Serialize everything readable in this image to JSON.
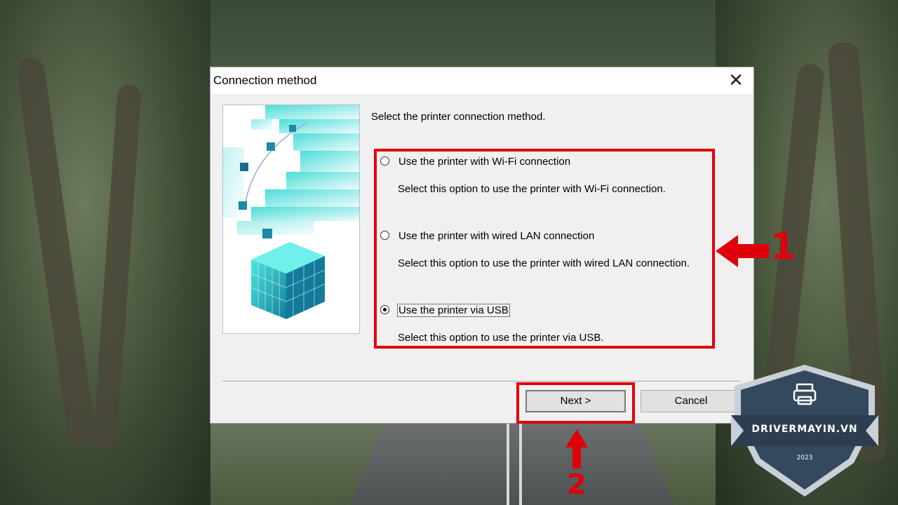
{
  "dialog": {
    "title": "Connection method",
    "close_glyph": "✕",
    "prompt": "Select the printer connection method.",
    "options": [
      {
        "label": "Use the printer with Wi-Fi connection",
        "description": "Select this option to use the printer with Wi-Fi connection.",
        "selected": false
      },
      {
        "label": "Use the printer with wired LAN connection",
        "description": "Select this option to use the printer with wired LAN connection.",
        "selected": false
      },
      {
        "label": "Use the printer via USB",
        "description": "Select this option to use the printer via USB.",
        "selected": true
      }
    ],
    "buttons": {
      "next": "Next >",
      "cancel": "Cancel"
    }
  },
  "annotations": {
    "step1": "1",
    "step2": "2",
    "color": "#e0000b"
  },
  "watermark": {
    "site": "DRIVERMAYIN.VN",
    "year": "2023",
    "icon": "printer-icon"
  }
}
